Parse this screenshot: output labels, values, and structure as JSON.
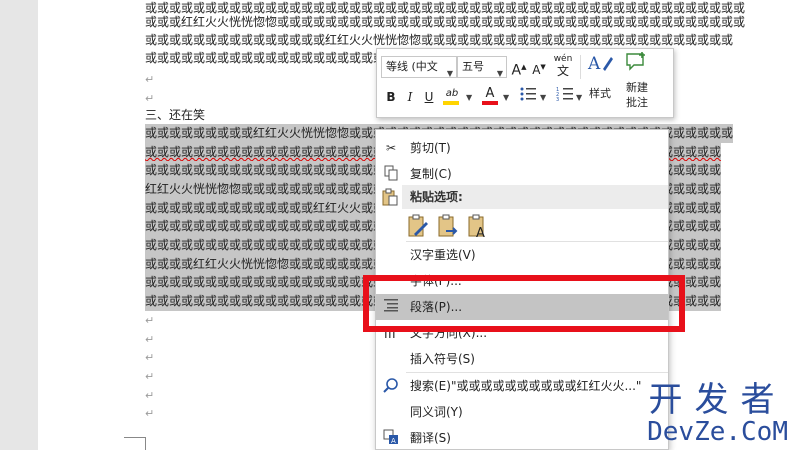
{
  "document": {
    "heading": "三、还在笑",
    "para_mark": "↵",
    "lines_before": [
      "或或或或或或或或或或或或或或或或或或或或或或或或或或或或或或或或或或或或或或或或或或或或或或或或或或",
      "或或或红红火火恍恍惚惚或或或或或或或或或或或或或或或或或或或或或或或或或或或或或或或或或或或或或或或",
      "或或或或或或或或或或或或或或或红红火火恍恍惚惚或或或或或或或或或或或或或或或或或或或或或或或或或或",
      "或或或或或或或或或或或或或或或或或或或或或"
    ],
    "selected_lines": [
      "或或或或或或或或或红红火火恍恍惚惚或或或或或或或或或或或或或或或或或或或或或或或或或或或或或或或或",
      "或或或或或或或或或或或或或或或或或或或或或或或或或或或或或或或或或或或或或或或或或或或或或或或或",
      "或或或或或或或或或或或或或或或或或或或或或或或或或或或或或或或或或或或或或或或或或或或或或或或或",
      "红红火火恍恍惚惚或或或或或或或或或或或或或或或或或或或或或或或或或或或或或或或或或或或或或或或或",
      "或或或或或或或或或或或或或或红红火火或或或或或或或或或或或或或或或或或或或或或或或或或或或或或或",
      "或或或或或或或或或或或或或或或或或或或或或或或或或或或或或或或或或或或或或或或或或或或或或或或或",
      "或或或或或或或或或或或或或或或或或或或或或或或或或或或或或或或或或或或或或或或或或或或或或或或或",
      "或或或或红红火火恍恍惚惚或或或或或或或或或或或或或或或或或或或或或或或或或或或或或或或或或或或或",
      "或或或或或或或或或或或或或或或或或或或或或或或或或或或或或或或或或或或或或或或或或或或或或或或或",
      "或或或或或或或或或或或或或或或或或或或或或或或或或或或或或或或或或或或或或或或或或或或或或或或或"
    ]
  },
  "mini_toolbar": {
    "font_name": "等线 (中文",
    "font_size": "五号",
    "grow_font": "A",
    "shrink_font": "A",
    "phonetic": "wén",
    "styles_label": "样式",
    "new_comment_label_1": "新建",
    "new_comment_label_2": "批注",
    "bold": "B",
    "italic": "I",
    "underline": "U",
    "highlight": "ab",
    "font_color": "A",
    "highlight_color": "#ffd400",
    "font_color_value": "#e8101a"
  },
  "context_menu": {
    "cut": "剪切(T)",
    "copy": "复制(C)",
    "paste_options_header": "粘贴选项:",
    "reconvert": "汉字重选(V)",
    "font_partial": "字体(F)...",
    "paragraph": "段落(P)...",
    "text_direction_partial": "文字方向(X)...",
    "insert_symbol": "插入符号(S)",
    "search": "搜索(E)\"或或或或或或或或或或红红火火...\"",
    "synonyms": "同义词(Y)",
    "translate": "翻译(S)"
  },
  "watermark": {
    "cn": "开发者",
    "en": "DevZe.CoM"
  },
  "colors": {
    "accent_red": "#e8101a",
    "selection": "#c6c6c6",
    "watermark": "#2a4d9c"
  }
}
